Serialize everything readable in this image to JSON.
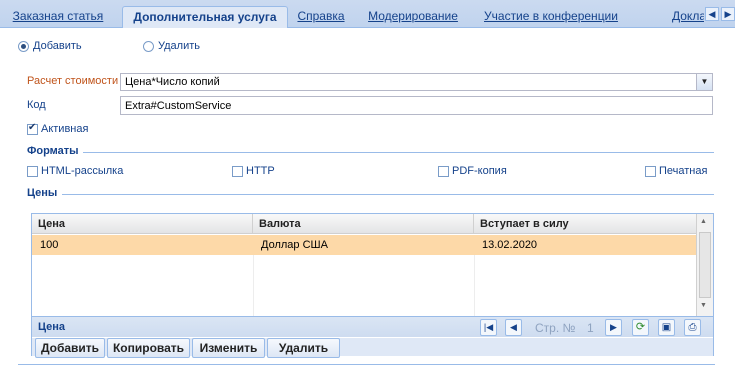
{
  "tabs": [
    {
      "label": "Заказная статья",
      "active": false
    },
    {
      "label": "Дополнительная услуга",
      "active": true
    },
    {
      "label": "Справка",
      "active": false
    },
    {
      "label": "Модерирование",
      "active": false
    },
    {
      "label": "Участие в конференции",
      "active": false
    },
    {
      "label": "Доклад",
      "active": false
    }
  ],
  "tab_nav": {
    "prev_icon": "chevron-left-icon",
    "next_icon": "chevron-right-icon"
  },
  "mode": {
    "add_label": "Добавить",
    "delete_label": "Удалить",
    "selected": "add"
  },
  "form": {
    "cost_label": "Расчет стоимости",
    "cost_value": "Цена*Число копий",
    "code_label": "Код",
    "code_value": "Extra#CustomService",
    "active_label": "Активная",
    "active_checked": true
  },
  "formats": {
    "title": "Форматы",
    "items": [
      {
        "label": "HTML-рассылка",
        "checked": false
      },
      {
        "label": "HTTP",
        "checked": false
      },
      {
        "label": "PDF-копия",
        "checked": false
      },
      {
        "label": "Печатная",
        "checked": false
      }
    ]
  },
  "prices": {
    "title": "Цены",
    "columns": [
      "Цена",
      "Валюта",
      "Вступает в силу"
    ],
    "rows": [
      {
        "price": "100",
        "currency": "Доллар США",
        "effective": "13.02.2020"
      }
    ],
    "paging": {
      "title": "Цена",
      "page_label": "Стр. №",
      "page_number": "1"
    },
    "buttons": {
      "add": "Добавить",
      "copy": "Копировать",
      "edit": "Изменить",
      "delete": "Удалить"
    }
  },
  "colors": {
    "accent": "#15428b",
    "selected_row": "#fdd9a8",
    "required_label": "#c0541b"
  }
}
